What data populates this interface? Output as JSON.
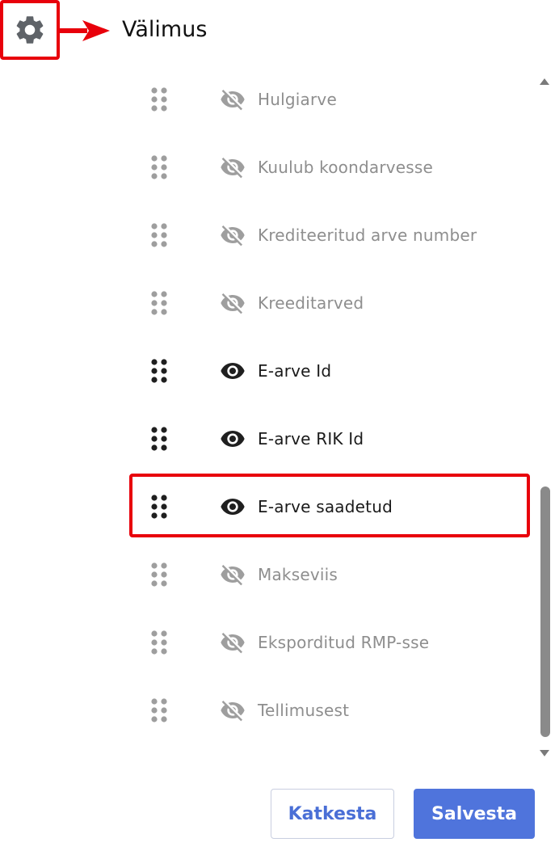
{
  "header": {
    "title": "Välimus",
    "settings_icon": "gear-icon",
    "callout_color": "#e8000b"
  },
  "columns": [
    {
      "label": "Hulgiarve",
      "visible": false
    },
    {
      "label": "Kuulub koondarvesse",
      "visible": false
    },
    {
      "label": "Krediteeritud arve number",
      "visible": false
    },
    {
      "label": "Kreeditarved",
      "visible": false
    },
    {
      "label": "E-arve Id",
      "visible": true
    },
    {
      "label": "E-arve RIK Id",
      "visible": true
    },
    {
      "label": "E-arve saadetud",
      "visible": true,
      "highlighted": true
    },
    {
      "label": "Makseviis",
      "visible": false
    },
    {
      "label": "Eksporditud RMP-sse",
      "visible": false
    },
    {
      "label": "Tellimusest",
      "visible": false
    }
  ],
  "icons": {
    "drag": "drag-handle-icon",
    "visible": "eye-icon",
    "hidden": "eye-off-icon"
  },
  "footer": {
    "cancel_label": "Katkesta",
    "save_label": "Salvesta"
  },
  "colors": {
    "accent": "#4f74dc",
    "hidden_text": "#8e8e8e",
    "visible_text": "#1a1a1a"
  }
}
